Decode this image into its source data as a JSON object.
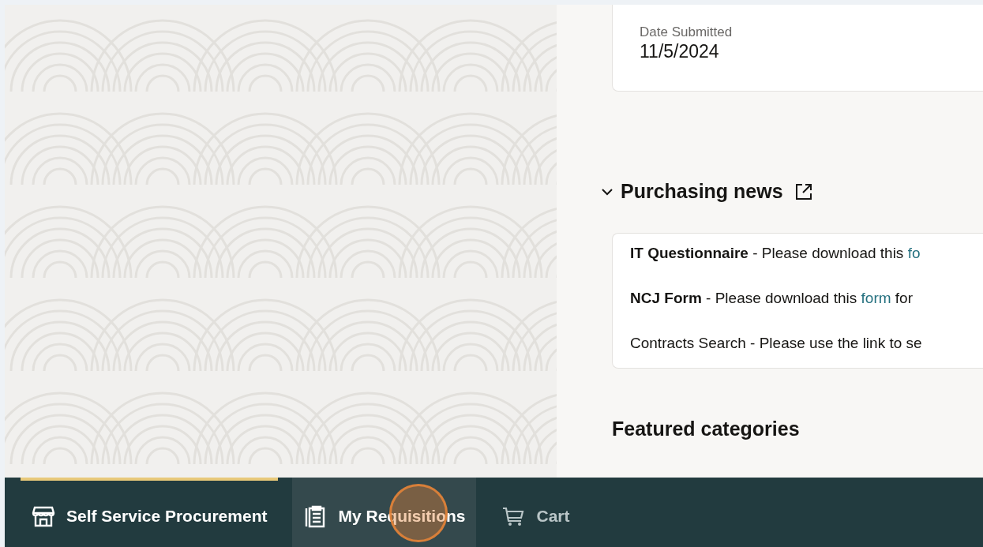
{
  "submission": {
    "label": "Date Submitted",
    "value": "11/5/2024"
  },
  "news": {
    "title": "Purchasing news",
    "expanded": true,
    "items": [
      {
        "title": "IT Questionnaire",
        "text": " - Please download this ",
        "link": "fo"
      },
      {
        "title": "NCJ Form",
        "text": " - Please download this ",
        "link": "form",
        "after": " for"
      },
      {
        "text": "Contracts Search - Please use the link to se"
      }
    ]
  },
  "featured": {
    "title": "Featured categories"
  },
  "nav": [
    {
      "label": "Self Service Procurement",
      "kind": "store",
      "selected": true,
      "hovered": false,
      "disabled": false
    },
    {
      "label": "My Requisitions",
      "kind": "clipboard",
      "selected": false,
      "hovered": true,
      "disabled": false
    },
    {
      "label": "Cart",
      "kind": "cart",
      "selected": false,
      "hovered": false,
      "disabled": true
    }
  ]
}
